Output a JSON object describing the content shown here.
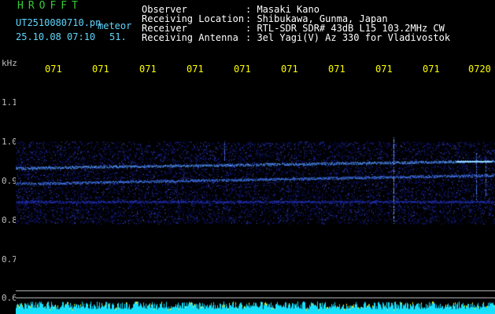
{
  "header": {
    "brand": "HROFFT",
    "filename": "UT2510080710.pn",
    "mode": "meteor",
    "datetime": "25.10.08 07:10",
    "seconds": "51.",
    "info_labels": [
      "Observer",
      "Receiving Location",
      "Receiver",
      "Receiving Antenna"
    ],
    "info_values": [
      ": Masaki Kano",
      ": Shibukawa, Gunma, Japan",
      ": RTL-SDR SDR# 43dB L15 103.2MHz CW",
      ": 3el Yagi(V) Az 330 for Vladivostok"
    ]
  },
  "axis": {
    "unit": "kHz",
    "y_ticks": [
      "1.1",
      "1.0",
      "0.9",
      "0.8",
      "0.7",
      "0.6"
    ],
    "time_ticks": [
      "071",
      "071",
      "071",
      "071",
      "071",
      "071",
      "071",
      "071",
      "071",
      "0720"
    ]
  },
  "colors": {
    "background": "#000000",
    "title_green": "#33cc33",
    "filename_cyan": "#5fd7ff",
    "time_yellow": "#ffff00",
    "signal_blue": "#1e2cff",
    "signal_bright": "#6fd0ff"
  }
}
